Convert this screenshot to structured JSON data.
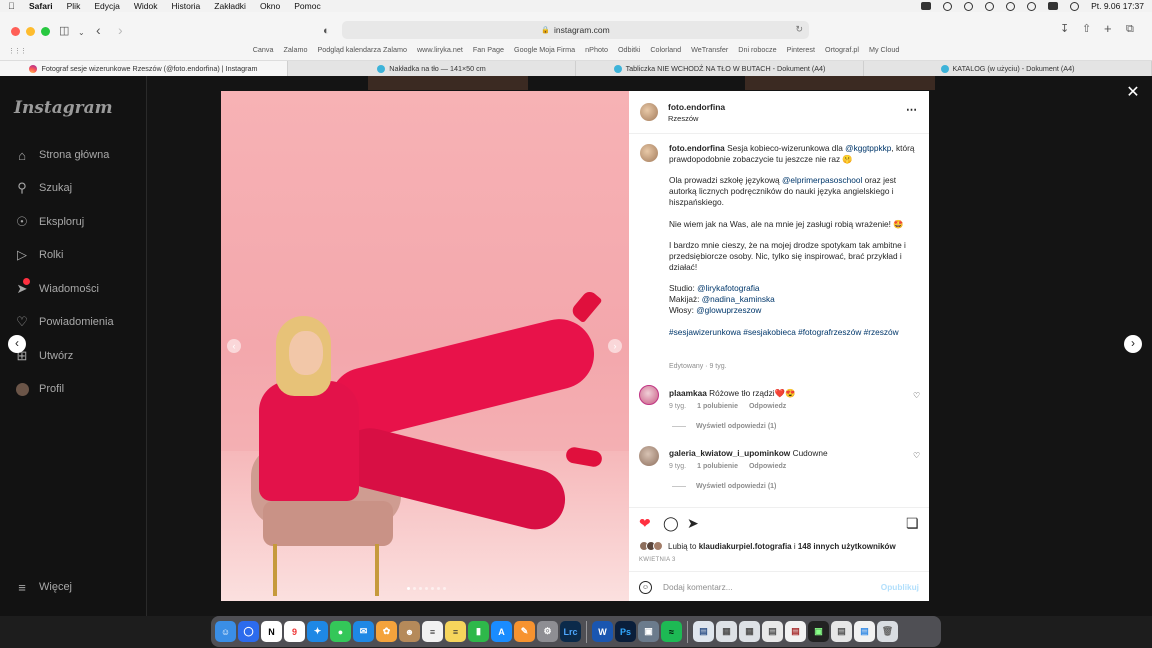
{
  "menubar": {
    "app": "Safari",
    "items": [
      "Plik",
      "Edycja",
      "Widok",
      "Historia",
      "Zakładki",
      "Okno",
      "Pomoc"
    ],
    "clock": "Pt. 9.06  17:37"
  },
  "browser": {
    "url": "instagram.com",
    "bookmarks": [
      "Canva",
      "Zalamo",
      "Podgląd kalendarza Zalamo",
      "www.liryka.net",
      "Fan Page",
      "Google Moja Firma",
      "nPhoto",
      "Odbitki",
      "Colorland",
      "WeTransfer",
      "Dni robocze",
      "Pinterest",
      "Ortograf.pl",
      "My Cloud"
    ],
    "tabs": [
      {
        "label": "Fotograf sesje wizerunkowe Rzeszów (@foto.endorfina) | Instagram",
        "icon": "instagram-icon"
      },
      {
        "label": "Nakładka na tło — 141×50 cm",
        "icon": "canva-icon"
      },
      {
        "label": "Tabliczka NIE WCHODŹ NA TŁO W BUTACH - Dokument (A4)",
        "icon": "canva-icon"
      },
      {
        "label": "KATALOG (w użyciu) - Dokument (A4)",
        "icon": "canva-icon"
      }
    ]
  },
  "sidebar": {
    "logo": "Instagram",
    "items": [
      {
        "label": "Strona główna",
        "icon": "home-icon"
      },
      {
        "label": "Szukaj",
        "icon": "search-icon"
      },
      {
        "label": "Eksploruj",
        "icon": "compass-icon"
      },
      {
        "label": "Rolki",
        "icon": "reels-icon"
      },
      {
        "label": "Wiadomości",
        "icon": "messenger-icon"
      },
      {
        "label": "Powiadomienia",
        "icon": "heart-icon"
      },
      {
        "label": "Utwórz",
        "icon": "plus-square-icon"
      },
      {
        "label": "Profil",
        "icon": "avatar-icon"
      }
    ],
    "more": "Więcej"
  },
  "post": {
    "username": "foto.endorfina",
    "location": "Rzeszów",
    "caption": {
      "intro": "Sesja kobieco-wizerunkowa dla",
      "mention1": "@kggtppkkp",
      "intro_end": ", którą prawdopodobnie zobaczycie tu jeszcze nie raz 🤫",
      "p2_a": "Ola prowadzi szkołę językową",
      "p2_mention": "@elprimerpasoschool",
      "p2_b": "oraz jest autorką licznych podręczników do nauki języka angielskiego i hiszpańskiego.",
      "p3": "Nie wiem jak na Was, ale na mnie jej zasługi robią wrażenie! 🤩",
      "p4": "I bardzo mnie cieszy, że na mojej drodze spotykam tak ambitne i przedsiębiorcze osoby. Nic, tylko się inspirować, brać przykład i działać!",
      "studio_label": "Studio:",
      "studio": "@lirykafotografia",
      "makeup_label": "Makijaż:",
      "makeup": "@nadina_kaminska",
      "hair_label": "Włosy:",
      "hair": "@glowuprzeszow",
      "hashtags": "#sesjawizerunkowa #sesjakobieca #fotografrzeszów #rzeszów"
    },
    "edited": "Edytowany · 9 tyg.",
    "comments": [
      {
        "user": "plaamkaa",
        "text": "Różowe tło rządzi❤️😍",
        "age": "9 tyg.",
        "likes": "1 polubienie",
        "reply": "Odpowiedz",
        "view_replies": "Wyświetl odpowiedzi (1)"
      },
      {
        "user": "galeria_kwiatow_i_upominkow",
        "text": "Cudowne",
        "age": "9 tyg.",
        "likes": "1 polubienie",
        "reply": "Odpowiedz",
        "view_replies": "Wyświetl odpowiedzi (1)"
      }
    ],
    "likes": {
      "prefix": "Lubią to",
      "user": "klaudiakurpiel.fotografia",
      "middle": "i",
      "others": "148 innych użytkowników"
    },
    "date": "KWIETNIA 3",
    "comment_placeholder": "Dodaj komentarz...",
    "publish": "Opublikuj"
  },
  "dock": [
    "Finder",
    "Signal",
    "Notion",
    "Kalendarz",
    "Safari",
    "Wiadomości",
    "Mail",
    "Zdjęcia",
    "Kontakty",
    "Przypomnienia",
    "Notatki",
    "Numbers",
    "App Store",
    "Pages",
    "Preferencje",
    "Lrc",
    "Word",
    "Ps",
    "Podgląd",
    "Spotify"
  ],
  "colors": {
    "accent": "#0095f6",
    "link": "#00376b",
    "photo_bg": "#f3a7ac",
    "suit": "#e3124a"
  }
}
